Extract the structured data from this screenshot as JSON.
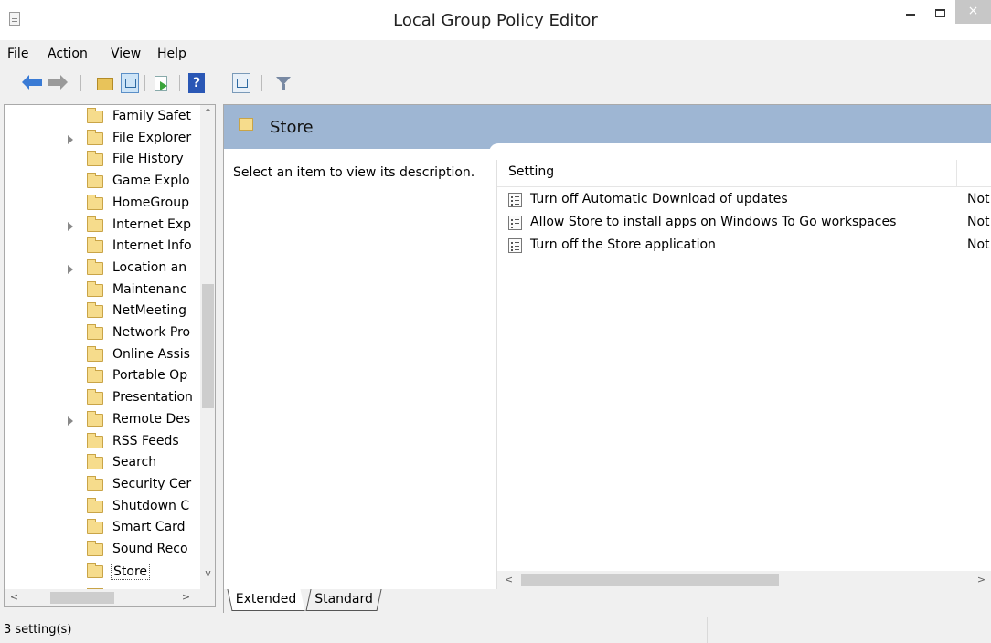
{
  "window": {
    "title": "Local Group Policy Editor",
    "close_glyph": "×"
  },
  "menu": [
    "File",
    "Action",
    "View",
    "Help"
  ],
  "toolbar": {
    "help_glyph": "?",
    "icons": [
      "back-arrow-icon",
      "forward-arrow-icon",
      "up-folder-icon",
      "show-hide-tree-icon",
      "export-list-icon",
      "help-icon",
      "properties-icon",
      "filter-icon"
    ]
  },
  "tree": {
    "items": [
      {
        "label": "Family Safet",
        "expandable": false
      },
      {
        "label": "File Explorer",
        "expandable": true
      },
      {
        "label": "File History",
        "expandable": false
      },
      {
        "label": "Game Explo",
        "expandable": false
      },
      {
        "label": "HomeGroup",
        "expandable": false
      },
      {
        "label": "Internet Exp",
        "expandable": true
      },
      {
        "label": "Internet Info",
        "expandable": false
      },
      {
        "label": "Location an",
        "expandable": true
      },
      {
        "label": "Maintenanc",
        "expandable": false
      },
      {
        "label": "NetMeeting",
        "expandable": false
      },
      {
        "label": "Network Pro",
        "expandable": false
      },
      {
        "label": "Online Assis",
        "expandable": false
      },
      {
        "label": "Portable Op",
        "expandable": false
      },
      {
        "label": "Presentation",
        "expandable": false
      },
      {
        "label": "Remote Des",
        "expandable": true
      },
      {
        "label": "RSS Feeds",
        "expandable": false
      },
      {
        "label": "Search",
        "expandable": false
      },
      {
        "label": "Security Cer",
        "expandable": false
      },
      {
        "label": "Shutdown C",
        "expandable": false
      },
      {
        "label": "Smart Card",
        "expandable": false
      },
      {
        "label": "Sound Reco",
        "expandable": false
      },
      {
        "label": "Store",
        "expandable": false,
        "selected": true
      }
    ],
    "scroll_up": "^",
    "scroll_down": "v",
    "scroll_left": "<",
    "scroll_right": ">"
  },
  "details": {
    "header_title": "Store",
    "description": "Select an item to view its description.",
    "column_setting": "Setting",
    "rows": [
      {
        "label": "Turn off Automatic Download of updates",
        "state": "Not"
      },
      {
        "label": "Allow Store to install apps on Windows To Go workspaces",
        "state": "Not"
      },
      {
        "label": "Turn off the Store application",
        "state": "Not"
      }
    ],
    "scroll_left": "<",
    "scroll_right": ">"
  },
  "tabs": {
    "extended": "Extended",
    "standard": "Standard"
  },
  "status": {
    "text": "3 setting(s)"
  }
}
